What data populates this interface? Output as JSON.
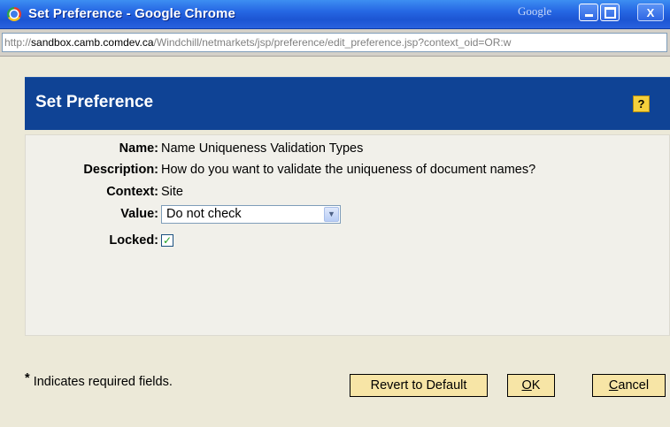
{
  "window": {
    "title": "Set Preference - Google Chrome",
    "brand_label": "Google",
    "close_glyph": "X"
  },
  "urlbar": {
    "url_prefix": "http://",
    "url_host": "sandbox.camb.comdev.ca",
    "url_path": "/Windchill/netmarkets/jsp/preference/edit_preference.jsp?context_oid=OR:w"
  },
  "header": {
    "title": "Set Preference",
    "help_glyph": "?"
  },
  "form": {
    "name_label": "Name:",
    "name_value": "Name Uniqueness Validation Types",
    "description_label": "Description:",
    "description_value": "How do you want to validate the uniqueness of document names?",
    "context_label": "Context:",
    "context_value": "Site",
    "value_label": "Value:",
    "value_selected": "Do not check",
    "locked_label": "Locked:",
    "locked_checked": true,
    "check_glyph": "✓"
  },
  "footer": {
    "required_star": "*",
    "required_note": "Indicates required fields.",
    "revert_label": "Revert to Default",
    "ok_mnemonic": "O",
    "ok_rest": "K",
    "cancel_mnemonic": "C",
    "cancel_rest": "ancel"
  },
  "colors": {
    "titlebar": "#2667e3",
    "header": "#0f4395",
    "button": "#f7e5a6",
    "panel": "#f1f0ea"
  }
}
